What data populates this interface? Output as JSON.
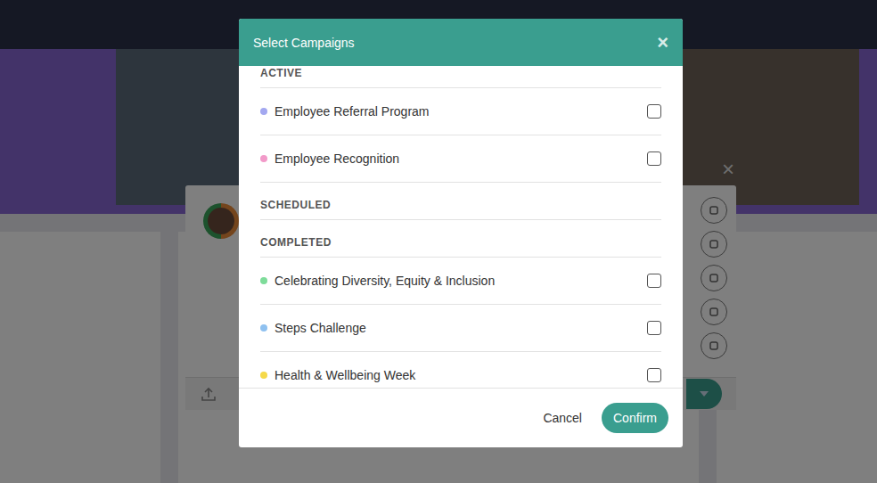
{
  "modal": {
    "title": "Select Campaigns",
    "close": "×"
  },
  "sections": [
    {
      "label": "ACTIVE",
      "campaigns": [
        {
          "name": "Employee Referral Program",
          "color": "#a3a8f0",
          "checked": false
        },
        {
          "name": "Employee Recognition",
          "color": "#f29ac9",
          "checked": false
        }
      ]
    },
    {
      "label": "SCHEDULED",
      "campaigns": []
    },
    {
      "label": "COMPLETED",
      "campaigns": [
        {
          "name": "Celebrating Diversity, Equity & Inclusion",
          "color": "#7edc9a",
          "checked": false
        },
        {
          "name": "Steps Challenge",
          "color": "#8fc1f0",
          "checked": false
        },
        {
          "name": "Health & Wellbeing Week",
          "color": "#f5d94a",
          "checked": false
        }
      ]
    }
  ],
  "buttons": {
    "cancel": "Cancel",
    "confirm": "Confirm"
  },
  "background": {
    "composer_close": "×"
  }
}
